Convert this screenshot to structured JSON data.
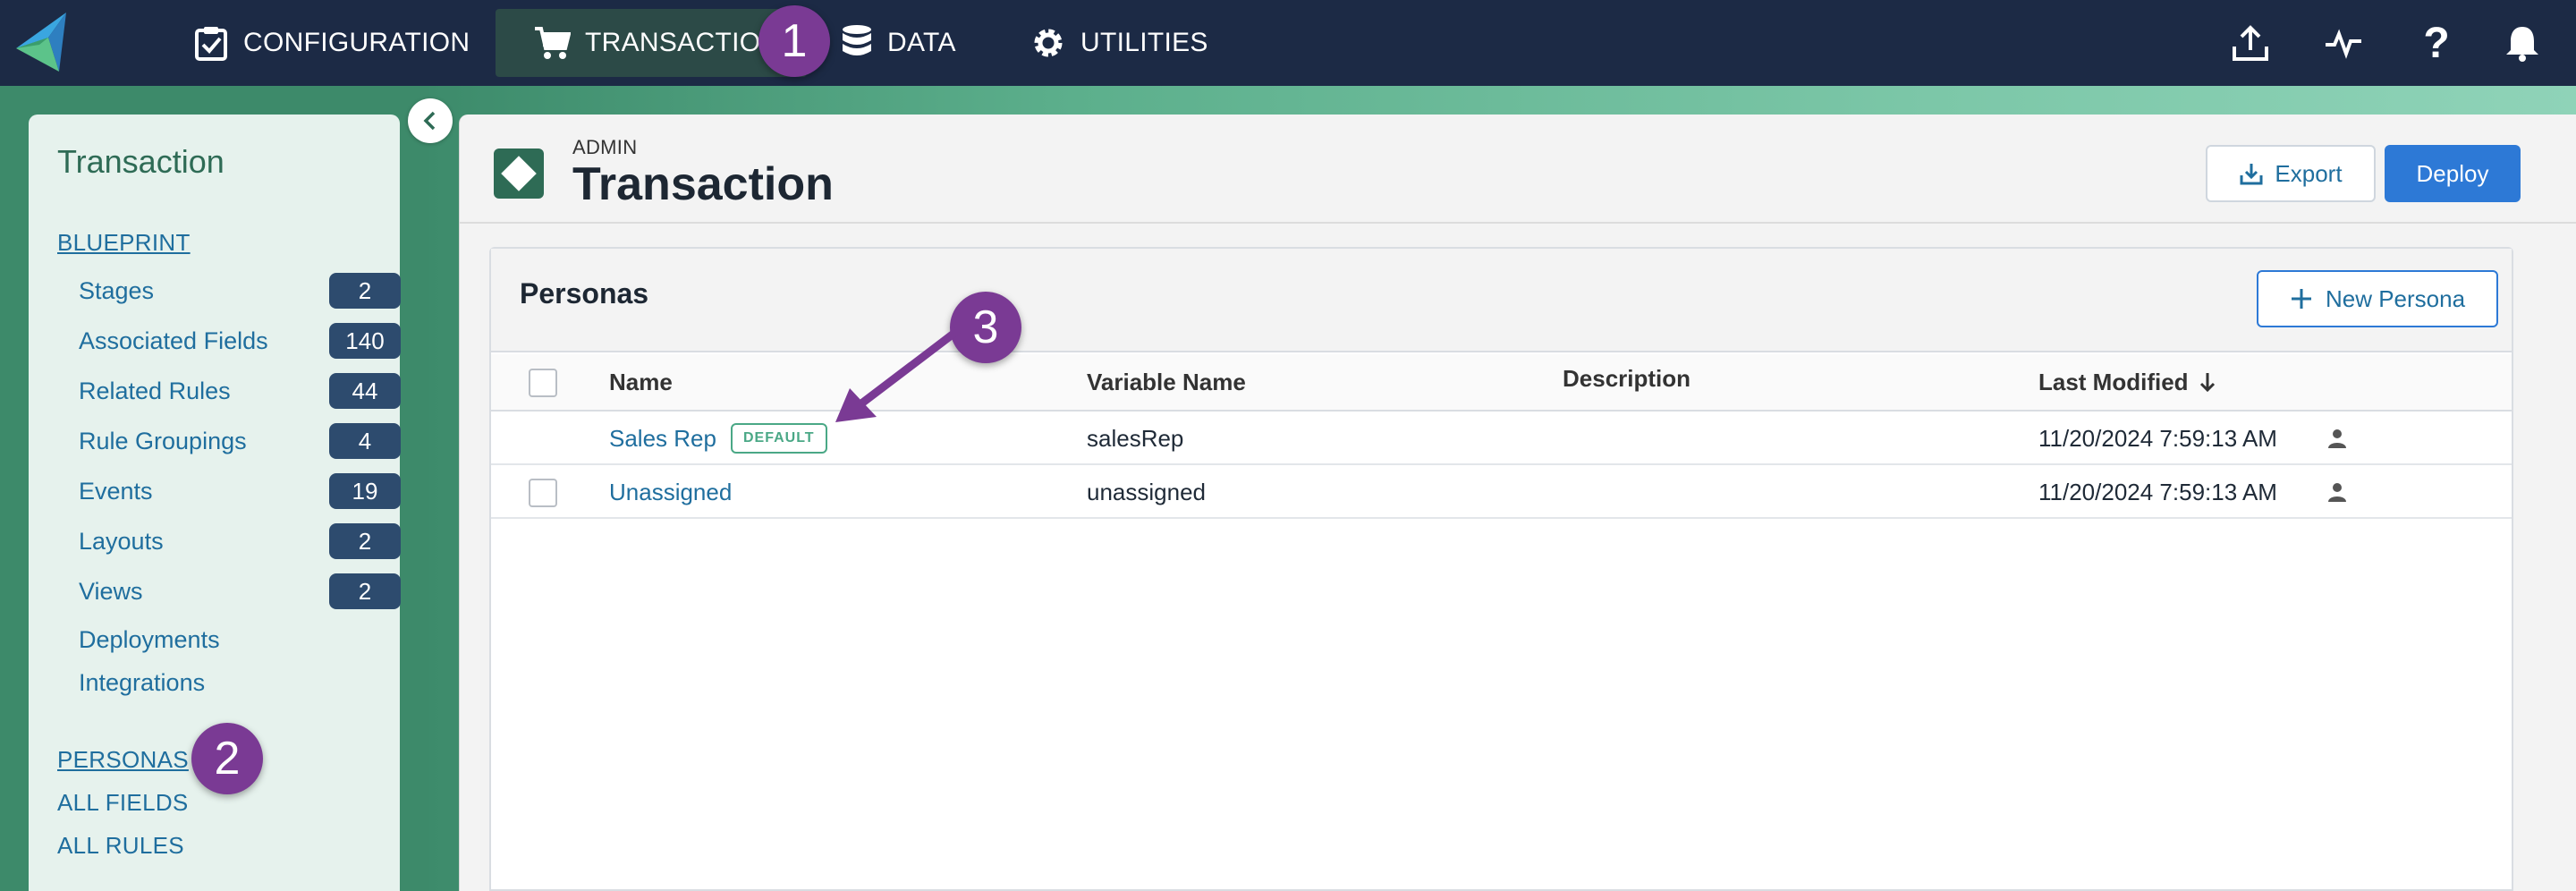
{
  "nav": {
    "items": [
      {
        "label": "CONFIGURATION",
        "icon": "clipboard-check-icon"
      },
      {
        "label": "TRANSACTION",
        "icon": "cart-icon",
        "active": true
      },
      {
        "label": "DATA",
        "icon": "database-icon"
      },
      {
        "label": "UTILITIES",
        "icon": "gear-icon"
      }
    ],
    "right_icons": [
      "upload-icon",
      "activity-icon",
      "help-icon",
      "bell-icon"
    ]
  },
  "sidebar": {
    "title": "Transaction",
    "blueprint_label": "BLUEPRINT",
    "items": [
      {
        "label": "Stages",
        "count": "2"
      },
      {
        "label": "Associated Fields",
        "count": "140"
      },
      {
        "label": "Related Rules",
        "count": "44"
      },
      {
        "label": "Rule Groupings",
        "count": "4"
      },
      {
        "label": "Events",
        "count": "19"
      },
      {
        "label": "Layouts",
        "count": "2"
      },
      {
        "label": "Views",
        "count": "2"
      },
      {
        "label": "Deployments"
      },
      {
        "label": "Integrations"
      }
    ],
    "personas_label": "PERSONAS",
    "all_fields_label": "ALL FIELDS",
    "all_rules_label": "ALL RULES"
  },
  "header": {
    "subtitle": "ADMIN",
    "title": "Transaction",
    "export_label": "Export",
    "deploy_label": "Deploy"
  },
  "personas": {
    "title": "Personas",
    "new_label": "New Persona",
    "columns": [
      "Name",
      "Variable Name",
      "Description",
      "Last Modified"
    ],
    "rows": [
      {
        "name": "Sales Rep",
        "badge": "DEFAULT",
        "variable": "salesRep",
        "description": "",
        "modified": "11/20/2024 7:59:13 AM"
      },
      {
        "name": "Unassigned",
        "variable": "unassigned",
        "description": "",
        "modified": "11/20/2024 7:59:13 AM"
      }
    ]
  },
  "markers": [
    "1",
    "2",
    "3"
  ],
  "colors": {
    "nav_bg": "#1c2a45",
    "accent_green": "#2e6b55",
    "primary_blue": "#2d79d6",
    "marker_purple": "#7a3a94",
    "badge_navy": "#2d4b6e"
  }
}
